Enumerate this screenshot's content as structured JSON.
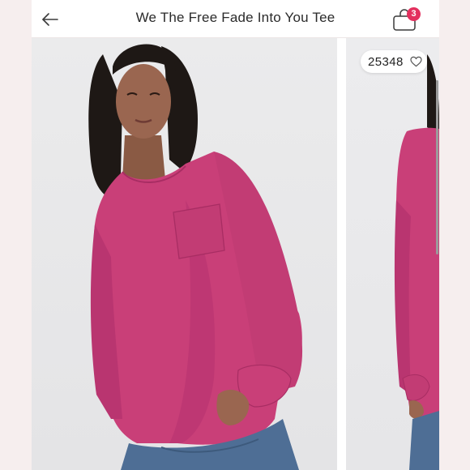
{
  "header": {
    "title": "We The Free Fade Into You Tee",
    "back_icon": "back-arrow-icon",
    "bag_icon": "shopping-bag-icon",
    "bag_count": "3"
  },
  "gallery": {
    "like_count": "25348",
    "like_icon": "heart-outline-icon",
    "photos": [
      "product-photo-front",
      "product-photo-side"
    ]
  },
  "colors": {
    "accent": "#e3305e",
    "shirt": "#c93f78",
    "background": "#f6eeee"
  }
}
